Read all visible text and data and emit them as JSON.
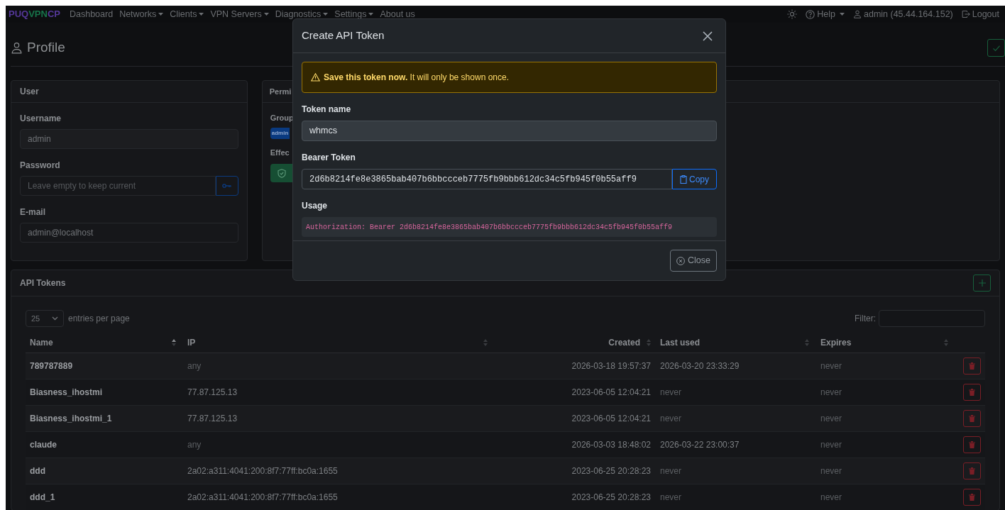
{
  "navbar": {
    "brand": [
      {
        "text": "PUQ",
        "color": "#55389a"
      },
      {
        "text": "VPN",
        "color": "#17744a"
      },
      {
        "text": "CP",
        "color": "#55389a"
      }
    ],
    "items": [
      {
        "label": "Dashboard",
        "dropdown": false
      },
      {
        "label": "Networks",
        "dropdown": true
      },
      {
        "label": "Clients",
        "dropdown": true
      },
      {
        "label": "VPN Servers",
        "dropdown": true
      },
      {
        "label": "Diagnostics",
        "dropdown": true
      },
      {
        "label": "Settings",
        "dropdown": true
      },
      {
        "label": "About us",
        "dropdown": false
      }
    ],
    "help": "Help",
    "user": "admin (45.44.164.152)",
    "logout": "Logout"
  },
  "page_title": "Profile",
  "user_card": {
    "title": "User",
    "username_label": "Username",
    "username": "admin",
    "password_label": "Password",
    "password_placeholder": "Leave empty to keep current",
    "email_label": "E-mail",
    "email": "admin@localhost"
  },
  "permissions_card": {
    "title": "Permi",
    "group_label": "Group",
    "group_badge": "admin",
    "effective_label": "Effec"
  },
  "api_tokens": {
    "title": "API Tokens",
    "page_size": "25",
    "entries_label": "entries per page",
    "filter_label": "Filter:",
    "columns": [
      {
        "label": "Name",
        "sorted_ascending": true
      },
      {
        "label": "IP",
        "sorted_ascending": false
      },
      {
        "label": "Created",
        "sorted_ascending": false
      },
      {
        "label": "Last used",
        "sorted_ascending": false
      },
      {
        "label": "Expires",
        "sorted_ascending": false
      }
    ],
    "rows": [
      {
        "name": "789787889",
        "ip": {
          "text": "any",
          "muted": true
        },
        "created": "2026-03-18 19:57:37",
        "last_used": {
          "text": "2026-03-20 23:33:29",
          "muted": false
        },
        "expires": {
          "text": "never",
          "muted": true
        }
      },
      {
        "name": "Biasness_ihostmi",
        "ip": {
          "text": "77.87.125.13",
          "muted": false
        },
        "created": "2023-06-05 12:04:21",
        "last_used": {
          "text": "never",
          "muted": true
        },
        "expires": {
          "text": "never",
          "muted": true
        }
      },
      {
        "name": "Biasness_ihostmi_1",
        "ip": {
          "text": "77.87.125.13",
          "muted": false
        },
        "created": "2023-06-05 12:04:21",
        "last_used": {
          "text": "never",
          "muted": true
        },
        "expires": {
          "text": "never",
          "muted": true
        }
      },
      {
        "name": "claude",
        "ip": {
          "text": "any",
          "muted": true
        },
        "created": "2026-03-03 18:48:02",
        "last_used": {
          "text": "2026-03-22 23:00:37",
          "muted": false
        },
        "expires": {
          "text": "never",
          "muted": true
        }
      },
      {
        "name": "ddd",
        "ip": {
          "text": "2a02:a311:4041:200:8f7:77ff:bc0a:1655",
          "muted": false
        },
        "created": "2023-06-25 20:28:23",
        "last_used": {
          "text": "never",
          "muted": true
        },
        "expires": {
          "text": "never",
          "muted": true
        }
      },
      {
        "name": "ddd_1",
        "ip": {
          "text": "2a02:a311:4041:200:8f7:77ff:bc0a:1655",
          "muted": false
        },
        "created": "2023-06-25 20:28:23",
        "last_used": {
          "text": "never",
          "muted": true
        },
        "expires": {
          "text": "never",
          "muted": true
        }
      }
    ]
  },
  "modal": {
    "title": "Create API Token",
    "alert": "**Save this token now.** It will only be shown once.",
    "token_name_label": "Token name",
    "token_name": "whmcs",
    "bearer_label": "Bearer Token",
    "bearer_token": "2d6b8214fe8e3865bab407b6bbccceb7775fb9bbb612dc34c5fb945f0b55aff9",
    "copy_button": "Copy",
    "usage_label": "Usage",
    "usage": "Authorization: Bearer 2d6b8214fe8e3865bab407b6bbccceb7775fb9bbb612dc34c5fb945f0b55aff9",
    "close_button": "Close"
  }
}
